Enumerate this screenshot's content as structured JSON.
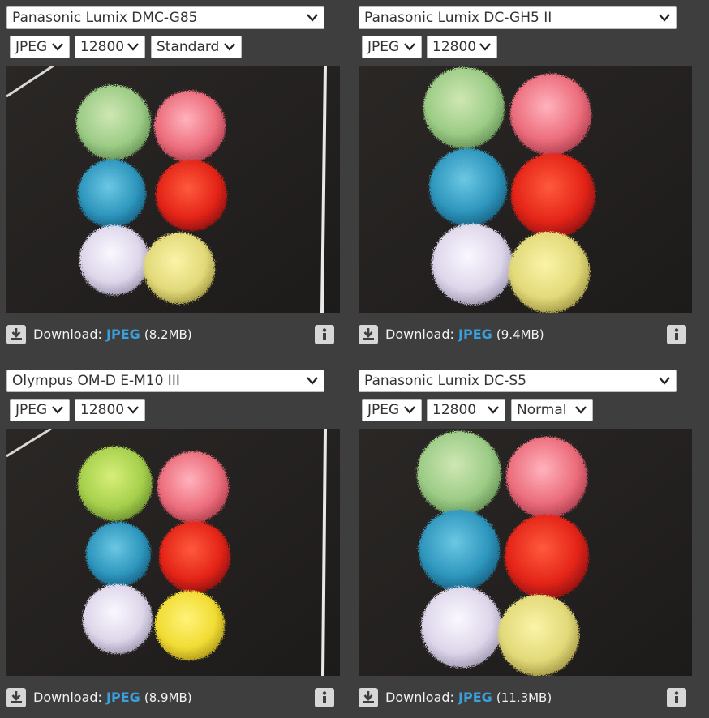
{
  "panels": [
    {
      "camera": "Panasonic Lumix DMC-G85",
      "format": "JPEG",
      "iso": "12800",
      "style": "Standard",
      "download_label": "Download:",
      "download_link": "JPEG",
      "download_size": "(8.2MB)"
    },
    {
      "camera": "Panasonic Lumix DC-GH5 II",
      "format": "JPEG",
      "iso": "12800",
      "download_label": "Download:",
      "download_link": "JPEG",
      "download_size": "(9.4MB)"
    },
    {
      "camera": "Olympus OM-D E-M10 III",
      "format": "JPEG",
      "iso": "12800",
      "download_label": "Download:",
      "download_link": "JPEG",
      "download_size": "(8.9MB)"
    },
    {
      "camera": "Panasonic Lumix DC-S5",
      "format": "JPEG",
      "iso": "12800",
      "style": "Normal",
      "download_label": "Download:",
      "download_link": "JPEG",
      "download_size": "(11.3MB)"
    }
  ],
  "icons": {
    "dropdown": "chevron-down-icon",
    "download": "download-icon",
    "info": "info-icon"
  },
  "colors": {
    "background": "#3e3e3e",
    "link": "#3aa0dc",
    "icon_bg": "#d7d7d7"
  }
}
